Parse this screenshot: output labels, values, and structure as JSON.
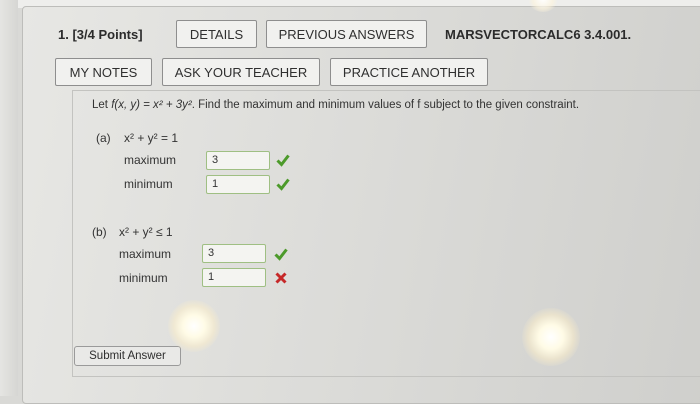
{
  "header": {
    "question_number": "1. [3/4 Points]",
    "details_label": "DETAILS",
    "previous_answers_label": "PREVIOUS ANSWERS",
    "source_tag": "MARSVECTORCALC6 3.4.001."
  },
  "toolbar": {
    "my_notes_label": "MY NOTES",
    "ask_teacher_label": "ASK YOUR TEACHER",
    "practice_another_label": "PRACTICE ANOTHER"
  },
  "question": {
    "prompt_prefix": "Let ",
    "function": "f(x, y) = x² + 3y²",
    "prompt_suffix": ". Find the maximum and minimum values of f subject to the given constraint.",
    "parts": [
      {
        "label": "(a)",
        "constraint": "x² + y² = 1",
        "maximum_label": "maximum",
        "maximum_value": "3",
        "maximum_status": "correct",
        "minimum_label": "minimum",
        "minimum_value": "1",
        "minimum_status": "correct"
      },
      {
        "label": "(b)",
        "constraint": "x² + y² ≤ 1",
        "maximum_label": "maximum",
        "maximum_value": "3",
        "maximum_status": "correct",
        "minimum_label": "minimum",
        "minimum_value": "1",
        "minimum_status": "incorrect"
      }
    ]
  },
  "submit_label": "Submit Answer",
  "colors": {
    "correct": "#4c9a2a",
    "incorrect": "#c62828",
    "input_border": "#9fbf83"
  },
  "icons": {
    "correct": "check-mark-icon",
    "incorrect": "x-mark-icon"
  }
}
